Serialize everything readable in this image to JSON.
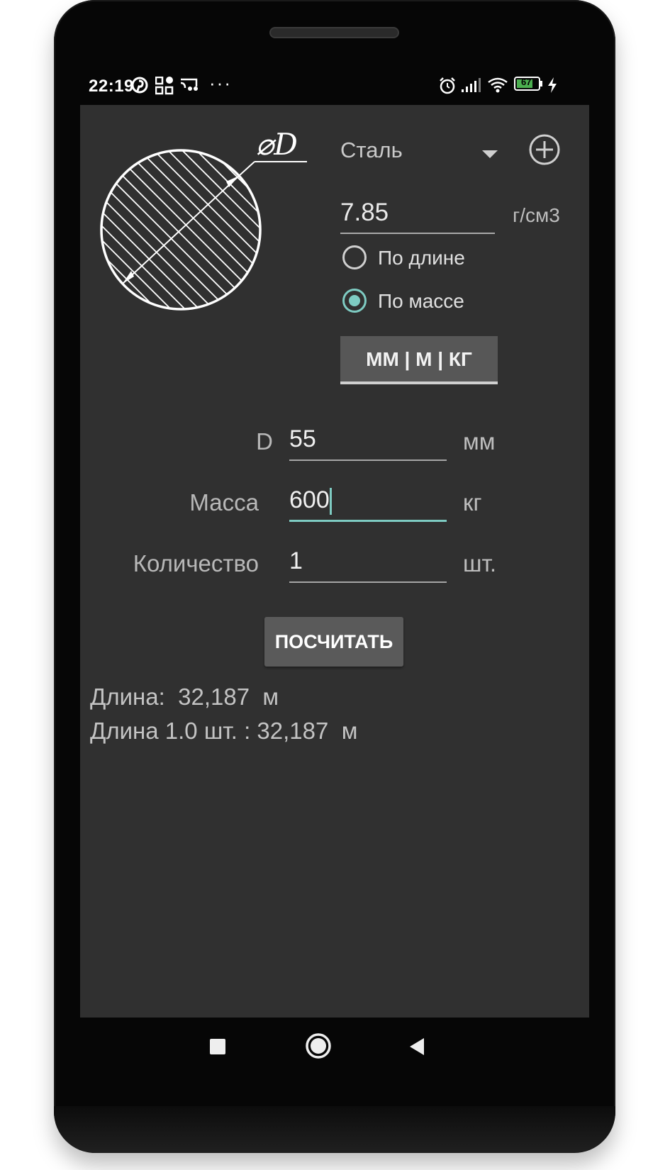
{
  "status_bar": {
    "time": "22:19",
    "battery": "67",
    "icons": [
      "pinterest-icon",
      "qr-app-icon",
      "cast-icon",
      "more-dots-icon",
      "alarm-icon",
      "signal-icon",
      "wifi-icon",
      "battery-icon",
      "charging-icon"
    ]
  },
  "drawing": {
    "label": "⌀D"
  },
  "material": {
    "selected": "Сталь"
  },
  "density": {
    "value": "7.85",
    "unit": "г/см3"
  },
  "mode": {
    "options": [
      {
        "label": "По длине",
        "selected": false
      },
      {
        "label": "По массе",
        "selected": true
      }
    ]
  },
  "units_button": "ММ | М | КГ",
  "fields": {
    "d": {
      "label": "D",
      "value": "55",
      "unit": "мм"
    },
    "mass": {
      "label": "Масса",
      "value": "600",
      "unit": "кг"
    },
    "qty": {
      "label": "Количество",
      "value": "1",
      "unit": "шт."
    }
  },
  "calc_button": "ПОСЧИТАТЬ",
  "results": {
    "line1": "Длина:  32,187  м",
    "line2": "Длина 1.0 шт. : 32,187  м"
  },
  "navbar": {
    "icons": [
      "recents-icon",
      "home-icon",
      "back-icon"
    ]
  },
  "colors": {
    "accent": "#7ecbc2",
    "background": "#303030",
    "button": "#5a5a5a"
  }
}
